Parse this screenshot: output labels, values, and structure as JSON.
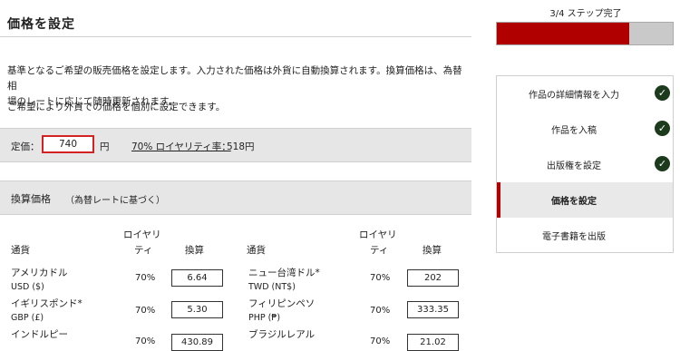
{
  "page": {
    "title": "価格を設定"
  },
  "description": {
    "line1": "基準となるご希望の販売価格を設定します。入力された価格は外貨に自動換算されます。換算価格は、為替相",
    "line2": "場のレートに応じて随時更新されます。",
    "line3": "ご希望により外貨での価格を個別に設定できます。"
  },
  "price": {
    "label": "定価：",
    "value": "740",
    "unit": "円",
    "royalty_link": "70% ロイヤリティ率：",
    "royalty_value": "518円"
  },
  "conversion": {
    "title": "換算価格",
    "note": "（為替レートに基づく）",
    "headers": {
      "currency": "通貨",
      "royalty_line1": "ロイヤリ",
      "royalty_line2": "ティ",
      "converted": "換算"
    },
    "left": [
      {
        "name": "アメリカドル",
        "code": "USD ($)",
        "royalty": "70%",
        "value": "6.64"
      },
      {
        "name": "イギリスポンド*",
        "code": "GBP (£)",
        "royalty": "70%",
        "value": "5.30"
      },
      {
        "name": "インドルピー",
        "code": "",
        "royalty": "70%",
        "value": "430.89"
      }
    ],
    "right": [
      {
        "name": "ニュー台湾ドル*",
        "code": "TWD (NT$)",
        "royalty": "70%",
        "value": "202"
      },
      {
        "name": "フィリピンペソ",
        "code": "PHP (₱)",
        "royalty": "70%",
        "value": "333.35"
      },
      {
        "name": "ブラジルレアル",
        "code": "",
        "royalty": "70%",
        "value": "21.02"
      }
    ]
  },
  "progress": {
    "label": "3/4 ステップ完了",
    "fraction": 0.75,
    "color": "#b10000"
  },
  "steps": [
    {
      "label": "作品の詳細情報を入力",
      "done": true
    },
    {
      "label": "作品を入稿",
      "done": true
    },
    {
      "label": "出版権を設定",
      "done": true
    },
    {
      "label": "価格を設定",
      "done": false,
      "active": true
    },
    {
      "label": "電子書籍を出版",
      "done": false
    }
  ],
  "icons": {
    "check": "check-circle-icon"
  }
}
